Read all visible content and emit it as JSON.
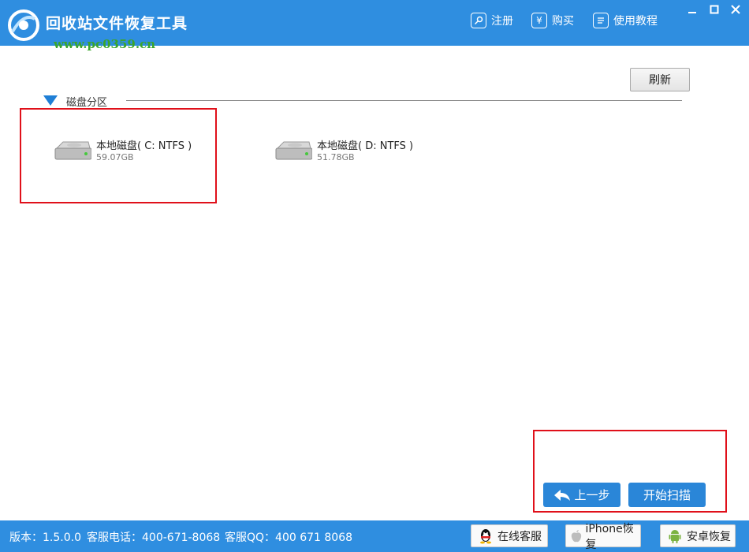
{
  "app": {
    "title": "回收站文件恢复工具",
    "watermark": "www.pc0359.cn"
  },
  "header": {
    "menu": [
      {
        "label": "注册",
        "icon": "key-icon"
      },
      {
        "label": "购买",
        "icon": "yen-icon"
      },
      {
        "label": "使用教程",
        "icon": "document-icon"
      }
    ],
    "window_controls": [
      "minimize",
      "maximize",
      "close"
    ]
  },
  "main": {
    "refresh_label": "刷新",
    "section_title": "磁盘分区",
    "disks": [
      {
        "name": "本地磁盘( C: NTFS )",
        "size": "59.07GB"
      },
      {
        "name": "本地磁盘( D: NTFS )",
        "size": "51.78GB"
      }
    ],
    "back_label": "上一步",
    "scan_label": "开始扫描"
  },
  "status": {
    "version": "版本：1.5.0.0",
    "phone": "客服电话：400-671-8068",
    "qq": "客服QQ：400 671 8068",
    "buttons": [
      {
        "label": "在线客服",
        "icon": "qq-penguin-icon"
      },
      {
        "label": "iPhone恢复",
        "icon": "apple-icon"
      },
      {
        "label": "安卓恢复",
        "icon": "android-icon"
      }
    ]
  },
  "colors": {
    "accent": "#2f8ee0",
    "button_blue": "#2a86d8",
    "highlight_red": "#e0101a",
    "watermark_green": "#3aa52a"
  }
}
